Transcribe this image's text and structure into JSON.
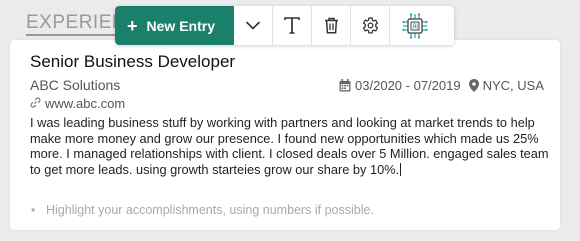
{
  "section": {
    "heading": "EXPERIENCE"
  },
  "toolbar": {
    "new_entry_label": "New Entry",
    "icons": [
      "plus-icon",
      "chevron-down-icon",
      "text-format-icon",
      "trash-icon",
      "gear-icon",
      "ai-chip-icon"
    ]
  },
  "entry": {
    "title": "Senior Business Developer",
    "company": "ABC Solutions",
    "dates": "03/2020 - 07/2019",
    "location": "NYC, USA",
    "website": "www.abc.com",
    "description": "I was leading business stuff by working with partners and looking at market trends to help make more money and grow our presence. I found new opportunities which made us 25% more. I managed relationships with client. I closed deals over 5 Million. engaged sales team to get more leads. using growth starteies grow our share by 10%.",
    "bullet_placeholder": "Highlight your accomplishments, using numbers if possible."
  },
  "colors": {
    "accent": "#1a806b",
    "background": "#ebebed",
    "card": "#ffffff",
    "muted_text": "#a9a9a9"
  }
}
